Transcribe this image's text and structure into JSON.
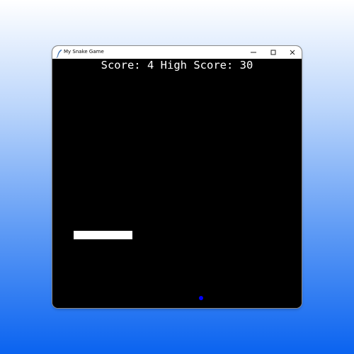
{
  "window": {
    "title": "My Snake Game",
    "icon": "feather-icon",
    "controls": [
      "minimize-icon",
      "maximize-icon",
      "close-icon"
    ]
  },
  "game": {
    "score_label": "Score:",
    "score_value": "4",
    "high_score_label": "High Score:",
    "high_score_value": "30",
    "background_color": "#000000",
    "snake_color": "#ffffff",
    "food_color": "#0000ff"
  }
}
